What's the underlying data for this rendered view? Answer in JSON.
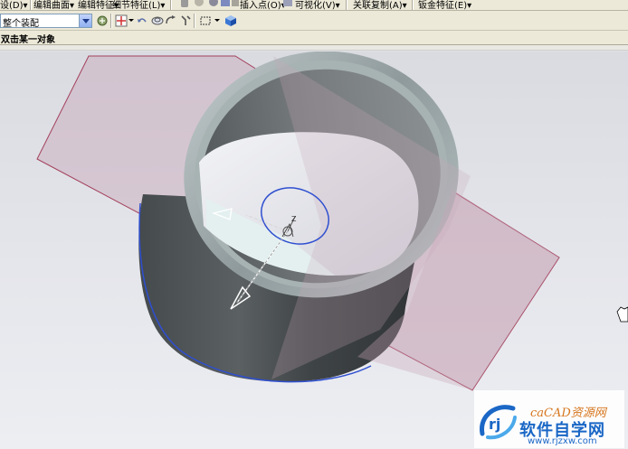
{
  "menu": {
    "items": [
      "设(D)▾",
      "编辑曲面▾",
      "编辑特征▾",
      "细节特征(L)▾",
      "插入点(O)▾",
      "可视化(V)▾",
      "关联复制(A)▾",
      "钣金特征(E)▾"
    ]
  },
  "toolbar": {
    "selection_filter": "整个装配"
  },
  "prompt": {
    "text": "双击某一对象"
  },
  "viewport": {
    "triad_label": "Z",
    "colors": {
      "plane_fill": "#c8a7b8",
      "plane_edge": "#a3405a",
      "cylinder_dark": "#4b5052",
      "edge_highlight": "#2f4fd0"
    }
  },
  "watermark": {
    "logo_text": "rj",
    "cad_line": "caCAD资源网",
    "title": "软件自学网",
    "url": "www.rjzxw.com"
  }
}
